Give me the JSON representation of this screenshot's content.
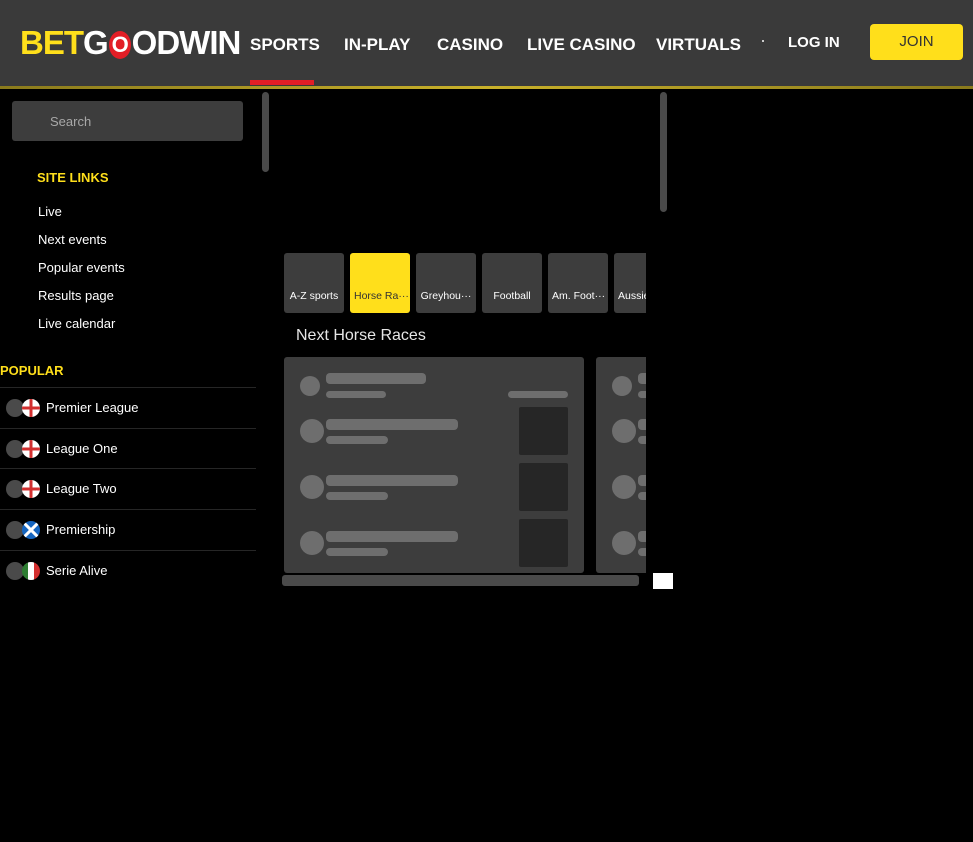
{
  "logo": {
    "bet": "BET",
    "o": "O",
    "rest": "ODWIN"
  },
  "nav": [
    {
      "label": "SPORTS",
      "active": true
    },
    {
      "label": "IN-PLAY"
    },
    {
      "label": "CASINO"
    },
    {
      "label": "LIVE CASINO"
    },
    {
      "label": "VIRTUALS"
    }
  ],
  "auth": {
    "login": "LOG IN",
    "join": "JOIN"
  },
  "search": {
    "placeholder": "Search"
  },
  "site_links": {
    "title": "SITE LINKS",
    "items": [
      "Live",
      "Next events",
      "Popular events",
      "Results page",
      "Live calendar"
    ]
  },
  "popular": {
    "title": "POPULAR",
    "items": [
      {
        "label": "Premier League",
        "flag": "england-flag-icon"
      },
      {
        "label": "League One",
        "flag": "england-flag-icon"
      },
      {
        "label": "League Two",
        "flag": "england-flag-icon"
      },
      {
        "label": "Premiership",
        "flag": "scotland-flag-icon"
      },
      {
        "label": "Serie Alive",
        "flag": "italy-flag-icon"
      }
    ]
  },
  "sport_tabs": [
    "A-Z sports",
    "Horse Ra···",
    "Greyhou···",
    "Football",
    "Am. Foot···",
    "Aussie"
  ],
  "active_tab": "Horse Ra···",
  "next_races_title": "Next Horse Races",
  "colors": {
    "accent": "#ffdf1b",
    "brand_red": "#e21e26",
    "header": "#3a3a3a",
    "panel": "#3d3d3d"
  }
}
